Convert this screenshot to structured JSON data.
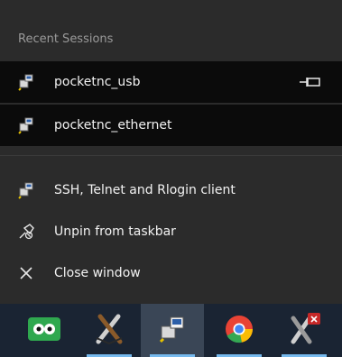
{
  "jumplist": {
    "section_title": "Recent Sessions",
    "recent": [
      {
        "label": "pocketnc_usb",
        "icon": "putty-session-icon",
        "pinned": true
      },
      {
        "label": "pocketnc_ethernet",
        "icon": "putty-session-icon",
        "pinned": false
      }
    ],
    "tasks": [
      {
        "label": "SSH, Telnet and Rlogin client",
        "icon": "putty-app-icon"
      },
      {
        "label": "Unpin from taskbar",
        "icon": "unpin-icon"
      },
      {
        "label": "Close window",
        "icon": "close-icon"
      }
    ]
  },
  "taskbar": {
    "apps": [
      {
        "name": "tripadvisor",
        "icon": "owl-eyes-icon",
        "active": false
      },
      {
        "name": "xming",
        "icon": "x-logo-icon",
        "active": false
      },
      {
        "name": "putty",
        "icon": "putty-app-icon",
        "active": true
      },
      {
        "name": "chrome",
        "icon": "chrome-icon",
        "active": false
      },
      {
        "name": "xlaunch",
        "icon": "x-badge-icon",
        "active": false
      }
    ]
  },
  "colors": {
    "menu_bg": "#2b2b2b",
    "recent_bg": "#0b0b0b",
    "text": "#f2f2f2",
    "header_text": "#9a9a9a",
    "taskbar_bg": "#1a2433",
    "active_bg": "#3a4656",
    "accent": "#76b9ed"
  }
}
